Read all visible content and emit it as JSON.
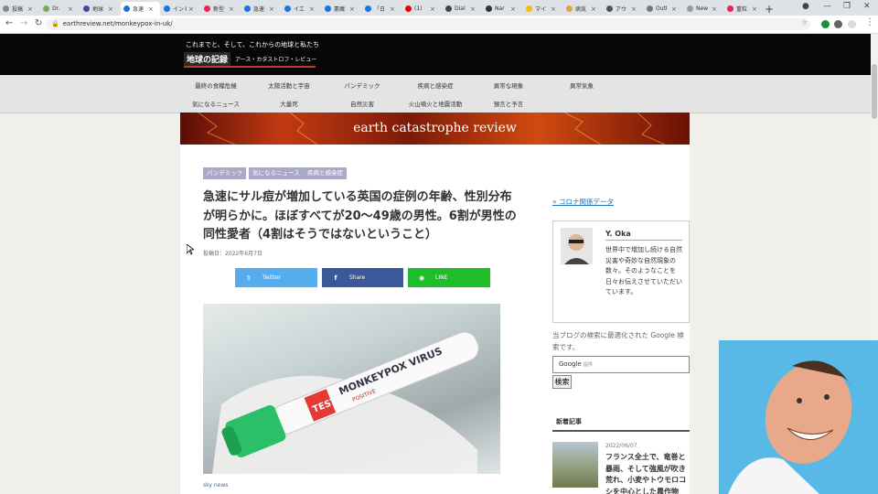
{
  "browser": {
    "tabs": [
      {
        "label": "投稿"
      },
      {
        "label": "Dr."
      },
      {
        "label": "地球"
      },
      {
        "label": "急速",
        "active": true
      },
      {
        "label": "インド"
      },
      {
        "label": "新型"
      },
      {
        "label": "急速"
      },
      {
        "label": "イエ"
      },
      {
        "label": "悪魔"
      },
      {
        "label": "「日"
      },
      {
        "label": "(1)"
      },
      {
        "label": "Dial"
      },
      {
        "label": "Nar"
      },
      {
        "label": "マイ"
      },
      {
        "label": "病気"
      },
      {
        "label": "アウ"
      },
      {
        "label": "Outl"
      },
      {
        "label": "New Tab"
      },
      {
        "label": "重粒"
      }
    ],
    "url": "earthreview.net/monkeypox-in-uk/"
  },
  "site": {
    "tagline": "これまでと、そして、これからの地球と私たち",
    "logo_jp": "地球の記録",
    "logo_sub": "アース・カタストロフ・レビュー",
    "banner": "earth catastrophe review"
  },
  "menu": {
    "row1": [
      "最終の食糧危機",
      "太陽活動と宇宙",
      "パンデミック",
      "疾病と感染症",
      "異常な現象",
      "異常気象"
    ],
    "row2": [
      "気になるニュース",
      "大量死",
      "自然災害",
      "火山噴火と地震活動",
      "預言と予言"
    ]
  },
  "article": {
    "categories": [
      "パンデミック",
      "気になるニュース",
      "疾病と感染症"
    ],
    "title": "急速にサル痘が増加している英国の症例の年齢、性別分布が明らかに。ほぼすべてが20〜49歳の男性。6割が男性の同性愛者（4割はそうではないということ）",
    "date": "投稿日：2022年6月7日",
    "share": {
      "twitter": "Twitter",
      "facebook": "Share",
      "line": "LINE"
    },
    "image_text": {
      "test": "TEST",
      "virus": "MONKEYPOX VIRUS",
      "positive": "POSITIVE"
    },
    "caption": "sky news"
  },
  "sidebar": {
    "covid_link": "» コロナ関係データ",
    "profile_name": "Y. Oka",
    "profile_bio": "世界中で増加し続ける自然災害や奇妙な自然現象の数々。そのようなことを日々お伝えさせていただいています。",
    "google_note": "当ブログの検索に最適化された Google 検索です。",
    "google_label": "Google",
    "google_sub": "提供",
    "search_button": "検索",
    "recent_heading": "新着記事",
    "recent_date": "2022/06/07",
    "recent_title": "フランス全土で、竜巻と暴雨、そして強風が吹き荒れ、小麦やトウモロコシを中心とした農作物"
  },
  "colors": {
    "twitter": "#55acee",
    "facebook": "#3b5998",
    "line": "#1dbe2a",
    "category": "#a9a9c9",
    "accent": "#c0392b"
  }
}
